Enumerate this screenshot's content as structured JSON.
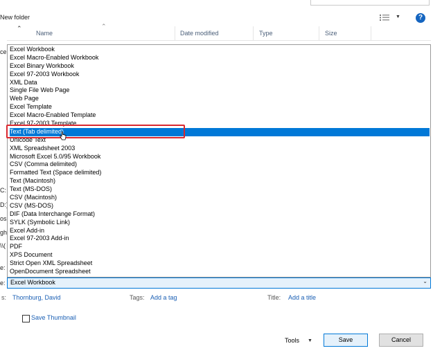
{
  "toolbar": {
    "new_folder": "New folder"
  },
  "header": {
    "columns": [
      "Name",
      "Date modified",
      "Type",
      "Size"
    ]
  },
  "left_edge": [
    "cel",
    "C:",
    "D:)",
    "os",
    "gh",
    "\\\\(",
    "e:",
    "e:"
  ],
  "file_types": [
    "Excel Workbook",
    "Excel Macro-Enabled Workbook",
    "Excel Binary Workbook",
    "Excel 97-2003 Workbook",
    "XML Data",
    "Single File Web Page",
    "Web Page",
    "Excel Template",
    "Excel Macro-Enabled Template",
    "Excel 97-2003 Template",
    "Text (Tab delimited)",
    "Unicode Text",
    "XML Spreadsheet 2003",
    "Microsoft Excel 5.0/95 Workbook",
    "CSV (Comma delimited)",
    "Formatted Text (Space delimited)",
    "Text (Macintosh)",
    "Text (MS-DOS)",
    "CSV (Macintosh)",
    "CSV (MS-DOS)",
    "DIF (Data Interchange Format)",
    "SYLK (Symbolic Link)",
    "Excel Add-in",
    "Excel 97-2003 Add-in",
    "PDF",
    "XPS Document",
    "Strict Open XML Spreadsheet",
    "OpenDocument Spreadsheet"
  ],
  "selected_index": 10,
  "save_as_type": "Excel Workbook",
  "meta": {
    "authors_label": "s:",
    "authors_value": "Thornburg, David",
    "tags_label": "Tags:",
    "tags_value": "Add a tag",
    "title_label": "Title:",
    "title_value": "Add a title"
  },
  "save_thumbnail": "Save Thumbnail",
  "buttons": {
    "tools": "Tools",
    "save": "Save",
    "cancel": "Cancel"
  },
  "colors": {
    "accent": "#0078d7",
    "highlight_box": "#d9272e",
    "link": "#1a5fb4"
  }
}
